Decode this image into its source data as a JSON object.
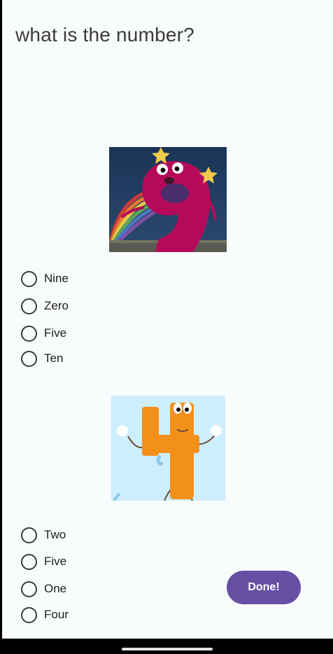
{
  "title": "what is the number?",
  "question1": {
    "image_icon": "nine-character-image",
    "options": [
      "Nine",
      "Zero",
      "Five",
      "Ten"
    ]
  },
  "question2": {
    "image_icon": "four-character-image",
    "options": [
      "Two",
      "Five",
      "One",
      "Four"
    ]
  },
  "done_label": "Done!",
  "colors": {
    "background": "#f8fcfd",
    "accent": "#6750a4",
    "nine_character": "#b50a5a",
    "four_character": "#f39019"
  }
}
